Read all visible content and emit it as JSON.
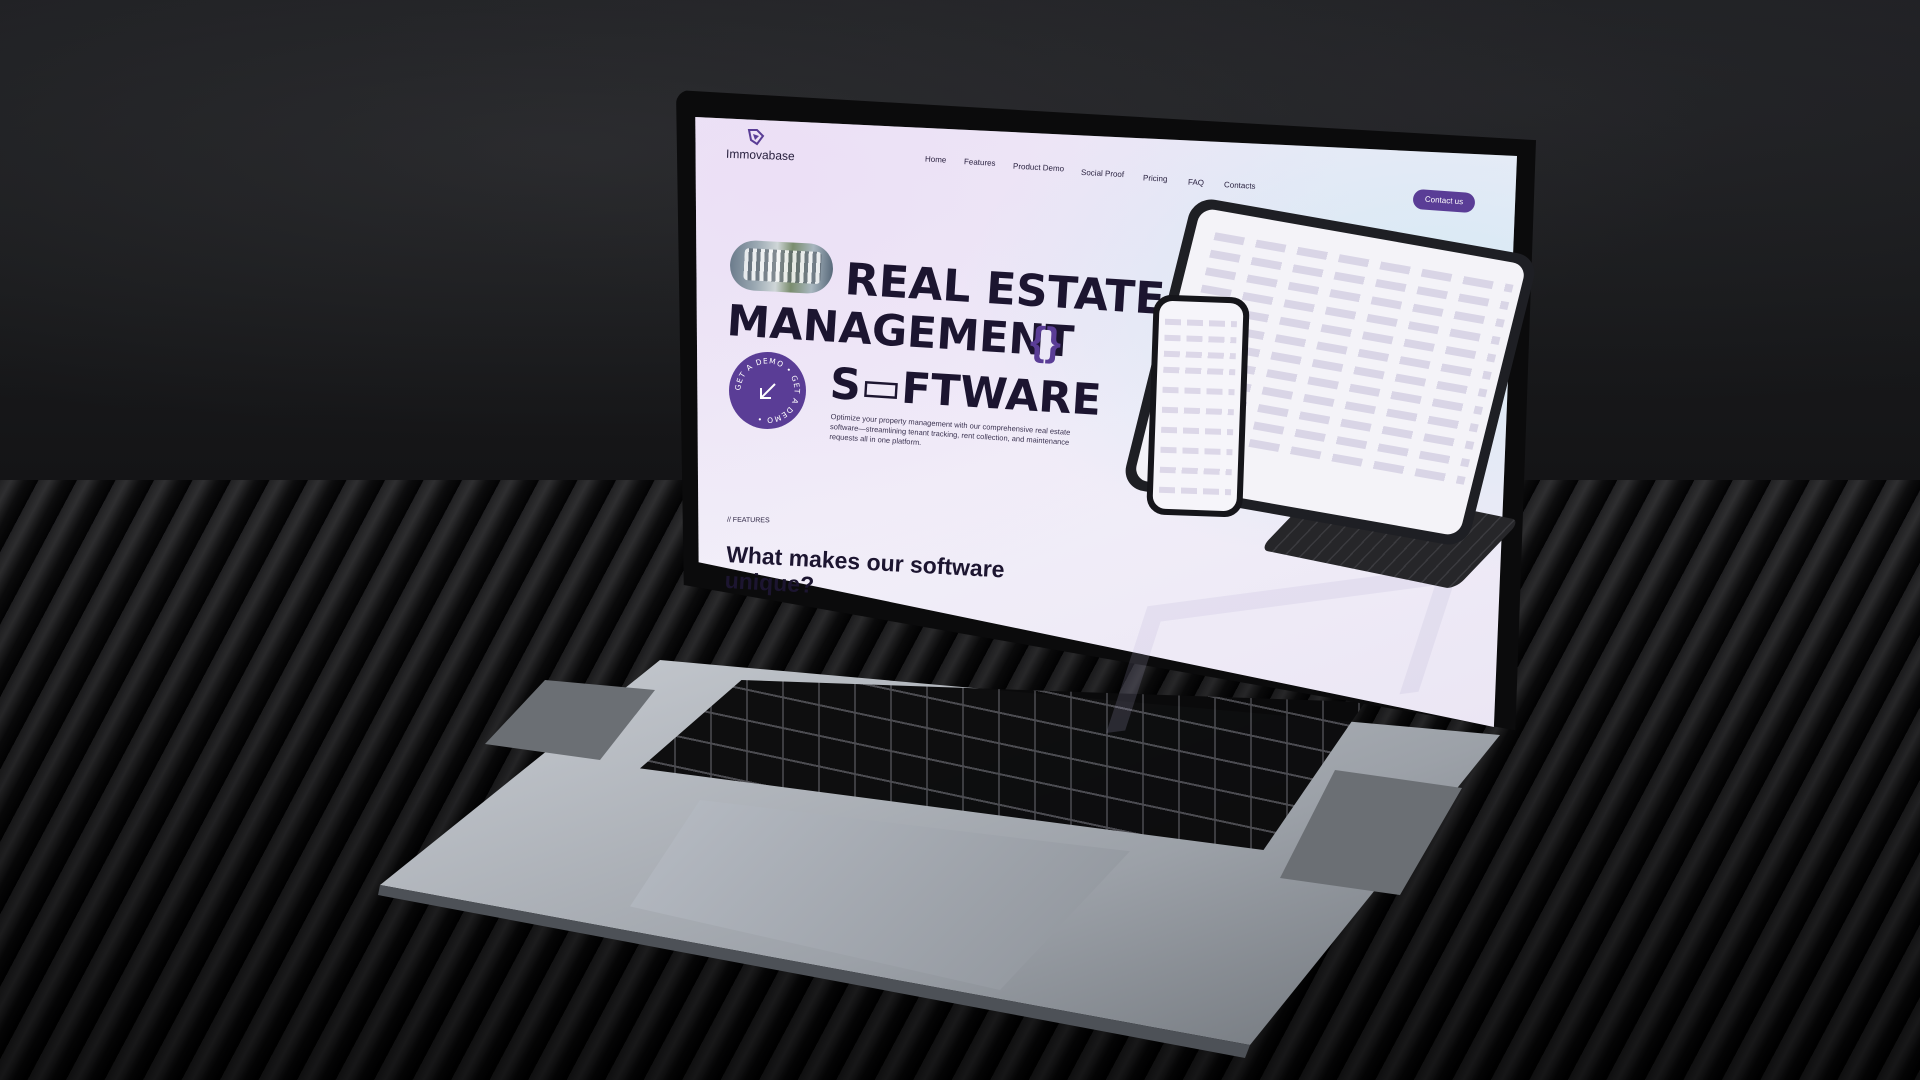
{
  "site": {
    "brand": "Immovabase",
    "nav": [
      "Home",
      "Features",
      "Product Demo",
      "Social Proof",
      "Pricing",
      "FAQ",
      "Contacts"
    ],
    "cta": "Contact us"
  },
  "hero": {
    "line1": "REAL ESTATE",
    "line2": "MANAGEMENT",
    "braces": "{}",
    "line3": "S▭FTWARE",
    "badge_text": "GET A DEMO • GET A DEMO •",
    "badge_icon": "arrow-down-left-icon",
    "description": "Optimize your property management with our comprehensive real estate software—streamlining tenant tracking, rent collection, and maintenance requests all in one platform."
  },
  "features": {
    "tag": "// FEATURES",
    "title": "What makes our software unique?"
  },
  "colors": {
    "accent": "#5a3d96",
    "text_dark": "#1c1530",
    "screen_bg": "#ece7f6"
  }
}
